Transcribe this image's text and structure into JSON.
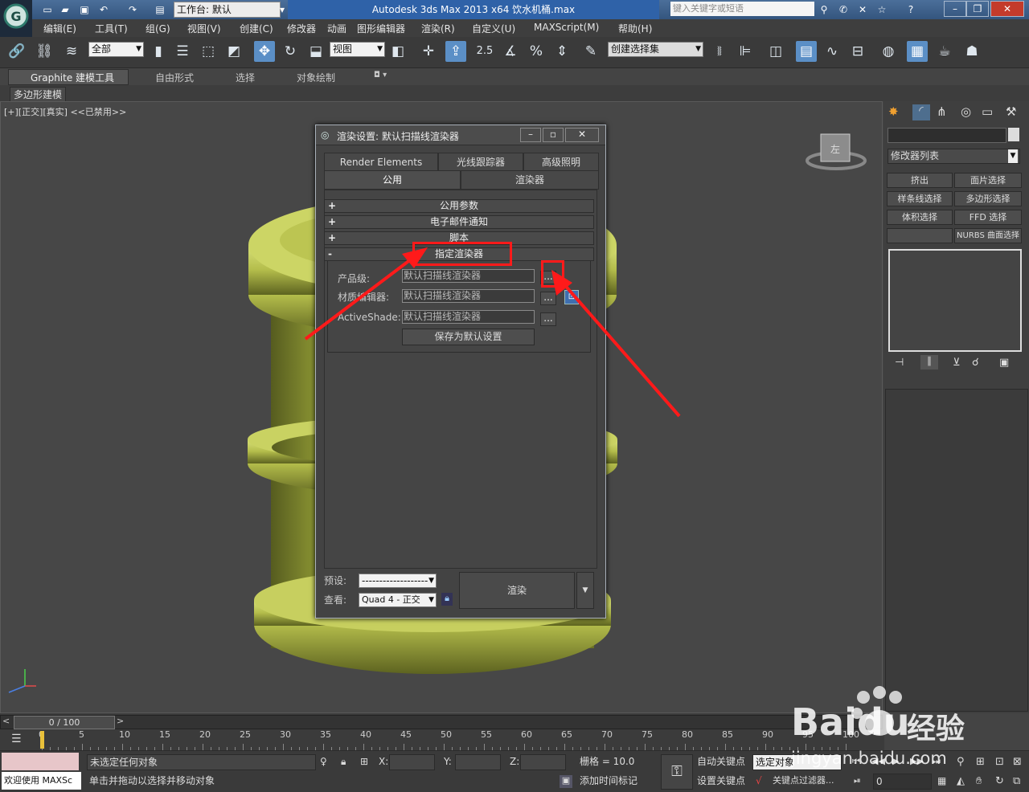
{
  "titlebar": {
    "workspace_label": "工作台: 默认",
    "app_title": "Autodesk 3ds Max  2013 x64      饮水机桶.max",
    "search_placeholder": "键入关键字或短语"
  },
  "menu": [
    "编辑(E)",
    "工具(T)",
    "组(G)",
    "视图(V)",
    "创建(C)",
    "修改器",
    "动画",
    "图形编辑器",
    "渲染(R)",
    "自定义(U)",
    "MAXScript(M)",
    "帮助(H)"
  ],
  "toolbar": {
    "selection_filter": "全部",
    "ref_coord": "视图",
    "snap_label": "2.5",
    "named_selection": "创建选择集"
  },
  "ribbon": {
    "tabs": [
      "Graphite 建模工具",
      "自由形式",
      "选择",
      "对象绘制"
    ],
    "subtab": "多边形建模"
  },
  "viewport": {
    "label": "[+][正交][真实]  <<已禁用>>"
  },
  "command_panel": {
    "modifier_list": "修改器列表",
    "buttons": [
      "挤出",
      "面片选择",
      "样条线选择",
      "多边形选择",
      "体积选择",
      "FFD 选择",
      "",
      "NURBS 曲面选择"
    ]
  },
  "dialog": {
    "title": "渲染设置: 默认扫描线渲染器",
    "tabs_row1": [
      "Render Elements",
      "光线跟踪器",
      "高级照明"
    ],
    "tabs_row2": [
      "公用",
      "渲染器"
    ],
    "rollouts": [
      "公用参数",
      "电子邮件通知",
      "脚本",
      "指定渲染器"
    ],
    "rollout_signs": [
      "+",
      "+",
      "+",
      "-"
    ],
    "fields": [
      {
        "label": "产品级:",
        "value": "默认扫描线渲染器"
      },
      {
        "label": "材质编辑器:",
        "value": "默认扫描线渲染器"
      },
      {
        "label": "ActiveShade:",
        "value": "默认扫描线渲染器"
      }
    ],
    "ellipsis": "...",
    "save_default": "保存为默认设置",
    "preset_label": "预设:",
    "preset_value": "-------------------",
    "view_label": "查看:",
    "view_value": "Quad 4 - 正交",
    "render_button": "渲染"
  },
  "timeline": {
    "frame_counter": "0 / 100",
    "ticks": [
      "0",
      "5",
      "10",
      "15",
      "20",
      "25",
      "30",
      "35",
      "40",
      "45",
      "50",
      "55",
      "60",
      "65",
      "70",
      "75",
      "80",
      "85",
      "90",
      "95",
      "100"
    ]
  },
  "status": {
    "script_prompt": "欢迎使用  MAXSc",
    "selection_status": "未选定任何对象",
    "hint": "单击并拖动以选择并移动对象",
    "x_label": "X:",
    "y_label": "Y:",
    "z_label": "Z:",
    "grid": "栅格 = 10.0",
    "add_time_tag": "添加时间标记",
    "auto_key": "自动关键点",
    "set_key": "设置关键点",
    "selected_object": "选定对象",
    "key_filter": "关键点过滤器...",
    "frame_value": "0"
  },
  "watermark": {
    "brand": "Baidu",
    "brand_cn": "经验",
    "url": "jingyan.baidu.com"
  },
  "colors": {
    "object": "#b9c251",
    "annotation": "#ff1a1a",
    "title_accent": "#2f62a8"
  }
}
